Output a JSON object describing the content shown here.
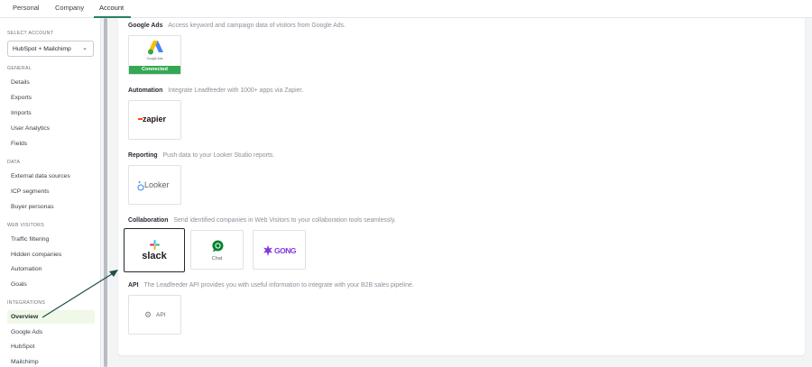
{
  "tabs": [
    {
      "label": "Personal"
    },
    {
      "label": "Company"
    },
    {
      "label": "Account"
    }
  ],
  "sidebar": {
    "select_account_label": "SELECT ACCOUNT",
    "select_account_value": "HubSpot + Mailchimp",
    "sections": [
      {
        "title": "GENERAL",
        "items": [
          "Details",
          "Exports",
          "Imports",
          "User Analytics",
          "Fields"
        ]
      },
      {
        "title": "DATA",
        "items": [
          "External data sources",
          "ICP segments",
          "Buyer personas"
        ]
      },
      {
        "title": "WEB VISITORS",
        "items": [
          "Traffic filtering",
          "Hidden companies",
          "Automation",
          "Goals"
        ]
      },
      {
        "title": "INTEGRATIONS",
        "items": [
          "Overview",
          "Google Ads",
          "HubSpot",
          "Mailchimp"
        ]
      }
    ]
  },
  "rows": [
    {
      "title": "Google Ads",
      "desc": "Access keyword and campaign data of visitors from Google Ads."
    },
    {
      "title": "Automation",
      "desc": "Integrate Leadfeeder with 1000+ apps via Zapier."
    },
    {
      "title": "Reporting",
      "desc": "Push data to your Looker Studio reports."
    },
    {
      "title": "Collaboration",
      "desc": "Send identified companies in Web Visitors to your collaboration tools seamlessly."
    },
    {
      "title": "API",
      "desc": "The Leadfeeder API provides you with useful information to integrate with your B2B sales pipeline."
    }
  ],
  "cards": {
    "google_ads_caption": "Google Ads",
    "google_ads_status": "Connected",
    "zapier": "zapier",
    "looker": "Looker",
    "slack": "slack",
    "chat": "Chat",
    "gong": "GONG",
    "api": "API"
  },
  "colors": {
    "accent": "#2a7f62",
    "connected": "#34a853",
    "active_bg": "#f0f8e8",
    "arrow": "#1e4d4a"
  }
}
